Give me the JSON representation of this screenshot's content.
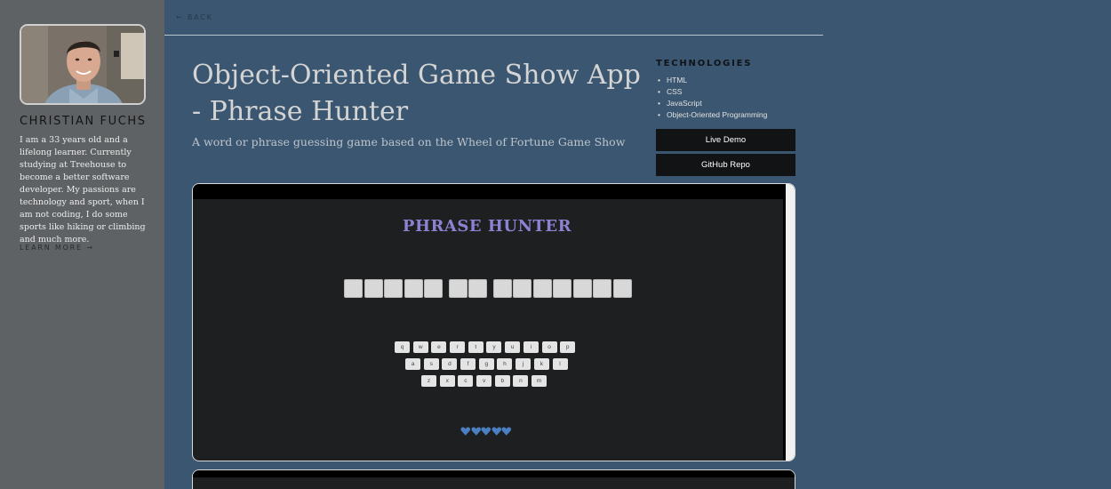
{
  "sidebar": {
    "name": "CHRISTIAN FUCHS",
    "bio": "I am a 33 years old and a lifelong learner. Currently studying at Treehouse to become a better software developer. My passions are technology and sport, when I am not coding, I do some sports like hiking or climbing and much more.",
    "learn_more": "LEARN MORE →"
  },
  "nav": {
    "back": "← BACK"
  },
  "project": {
    "title": "Object-Oriented Game Show App - Phrase Hunter",
    "subtitle": "A word or phrase guessing game based on the Wheel of Fortune Game Show"
  },
  "technologies": {
    "heading": "TECHNOLOGIES",
    "items": [
      "HTML",
      "CSS",
      "JavaScript",
      "Object-Oriented Programming"
    ]
  },
  "buttons": {
    "live_demo": "Live Demo",
    "github_repo": "GitHub Repo"
  },
  "game": {
    "title": "PHRASE HUNTER",
    "phrase_word_lengths": [
      5,
      2,
      7
    ],
    "keyboard": {
      "row1": [
        "q",
        "w",
        "e",
        "r",
        "t",
        "y",
        "u",
        "i",
        "o",
        "p"
      ],
      "row2": [
        "a",
        "s",
        "d",
        "f",
        "g",
        "h",
        "j",
        "k",
        "l"
      ],
      "row3": [
        "z",
        "x",
        "c",
        "v",
        "b",
        "n",
        "m"
      ]
    },
    "lives": 5,
    "heart_color": "#4a7fc1"
  },
  "colors": {
    "page_bg": "#3b5670",
    "sidebar_bg": "#5f6265",
    "game_title": "#8c82d2",
    "button_bg": "#121314"
  }
}
